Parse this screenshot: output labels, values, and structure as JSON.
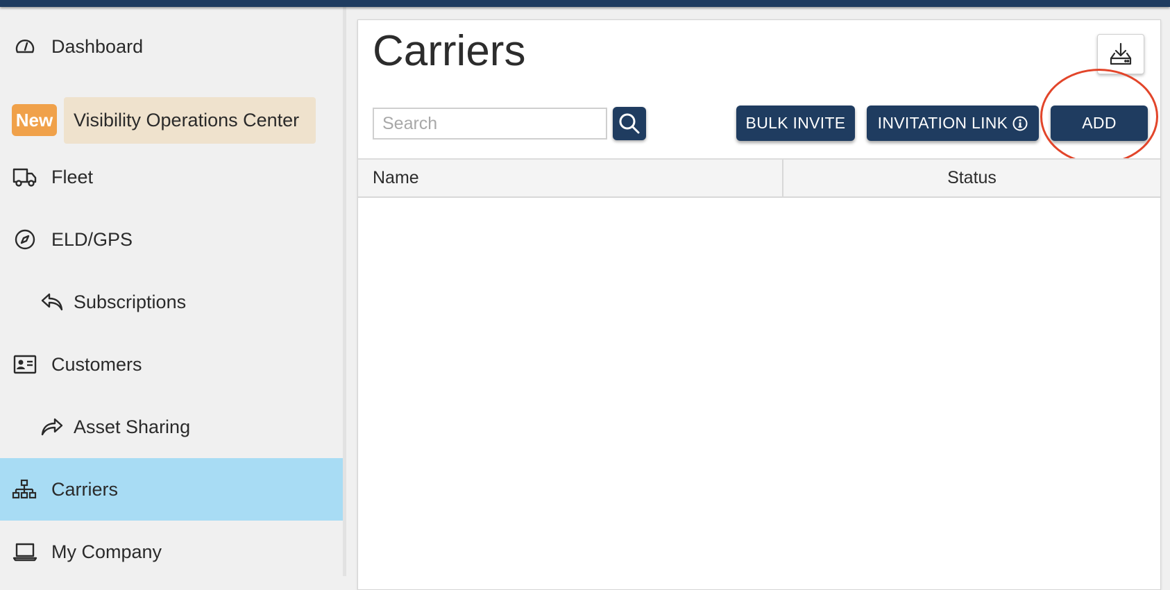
{
  "sidebar": {
    "items": [
      {
        "label": "Dashboard",
        "icon": "gauge-icon"
      },
      {
        "badge": "New",
        "label": "Visibility Operations Center"
      },
      {
        "label": "Fleet",
        "icon": "truck-icon"
      },
      {
        "label": "ELD/GPS",
        "icon": "compass-icon"
      },
      {
        "label": "Subscriptions",
        "icon": "reply-icon"
      },
      {
        "label": "Customers",
        "icon": "contact-card-icon"
      },
      {
        "label": "Asset Sharing",
        "icon": "share-icon"
      },
      {
        "label": "Carriers",
        "icon": "sitemap-icon",
        "active": true
      },
      {
        "label": "My Company",
        "icon": "laptop-icon"
      }
    ]
  },
  "main": {
    "title": "Carriers",
    "search": {
      "placeholder": "Search",
      "value": ""
    },
    "buttons": {
      "bulk_invite": "BULK INVITE",
      "invitation_link": "INVITATION LINK",
      "add": "ADD"
    },
    "table": {
      "columns": [
        "Name",
        "Status"
      ],
      "rows": []
    }
  },
  "colors": {
    "brand_navy": "#1f3c60",
    "active_nav": "#a8dcf4",
    "new_badge": "#f0a14a",
    "voc_highlight": "#efe2cd",
    "annotation_circle": "#e2452a"
  }
}
